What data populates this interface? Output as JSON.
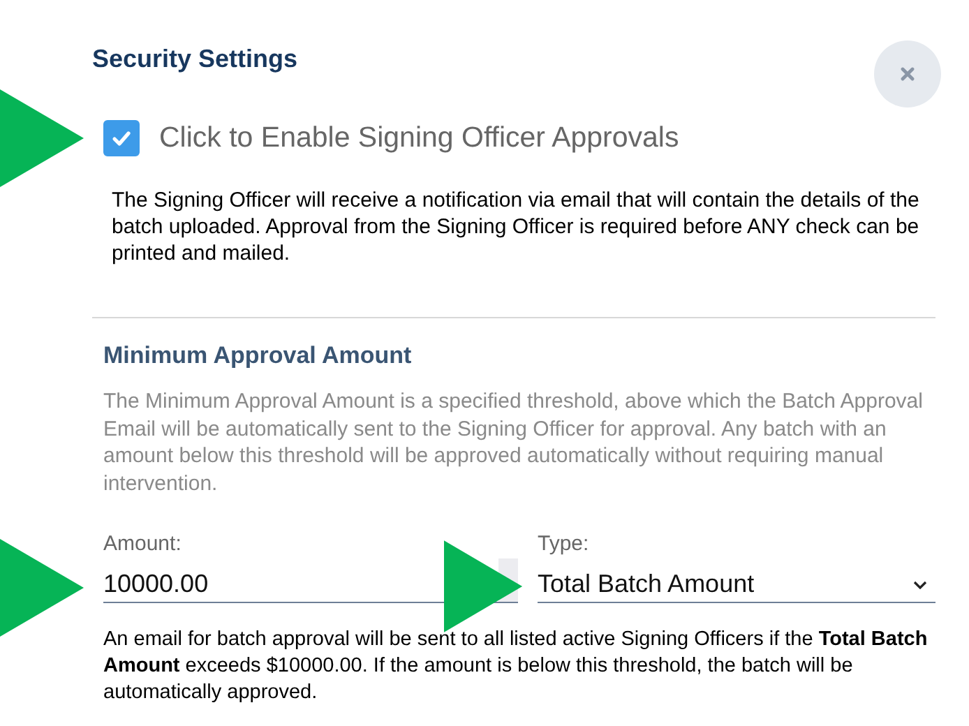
{
  "dialog": {
    "title": "Security Settings"
  },
  "approval_toggle": {
    "label": "Click to Enable Signing Officer Approvals",
    "checked": true
  },
  "description": "The Signing Officer will receive a notification via email that will contain the details of the batch uploaded. Approval from the Signing Officer is required before ANY check can be printed and mailed.",
  "minimum_section": {
    "heading": "Minimum Approval Amount",
    "description": "The Minimum Approval Amount is a specified threshold, above which the Batch Approval Email will be automatically sent to the Signing Officer for approval. Any batch with an amount below this threshold will be approved automatically without requiring manual intervention.",
    "amount": {
      "label": "Amount:",
      "value": "10000.00"
    },
    "type": {
      "label": "Type:",
      "value": "Total Batch Amount"
    },
    "note": "An email for batch approval will be sent to all listed active Signing Officers if the **Total Batch Amount** exceeds $10000.00. If the amount is below this threshold, the batch will be automatically approved."
  }
}
